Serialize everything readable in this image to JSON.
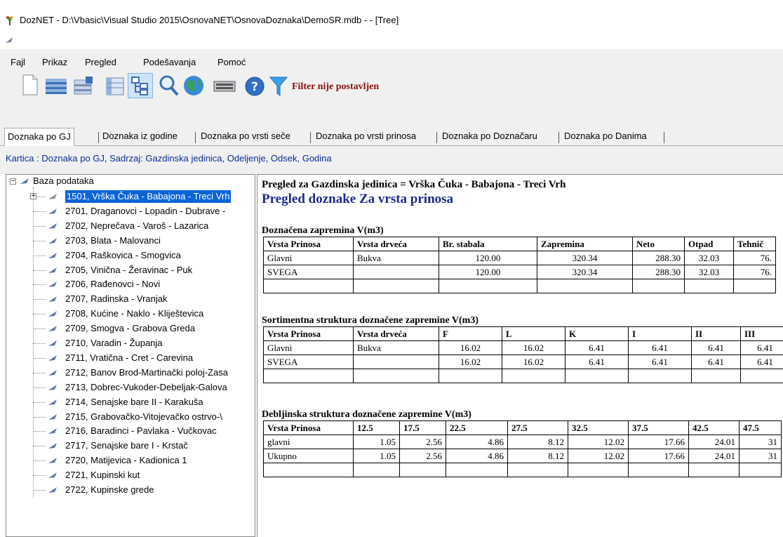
{
  "window": {
    "title": "DozNET - D:\\Vbasic\\Visual Studio 2015\\OsnovaNET\\OsnovaDoznaka\\DemoSR.mdb -  - [Tree]"
  },
  "menu": {
    "items": [
      "Fajl",
      "Prikaz",
      "Pregled",
      "Podešavanja",
      "Pomoć"
    ]
  },
  "toolbar": {
    "filter_text": "Filter nije postavljen"
  },
  "tabs": [
    "Doznaka po GJ",
    "Doznaka iz godine",
    "Doznaka po vrsti seče",
    "Doznaka po vrsti prinosa",
    "Doznaka po Doznačaru",
    "Doznaka po Danima"
  ],
  "kartica": "Kartica :  Doznaka po GJ, Sadrzaj: Gazdinska jedinica, Odeljenje, Odsek, Godina",
  "tree": {
    "root": "Baza podataka",
    "items": [
      "1501, Vrška Čuka - Babajona - Treci Vrh",
      "2701, Draganovci - Lopadin - Dubrave -",
      "2702, Neprečava - Varoš - Lazarica",
      "2703, Blata - Malovanci",
      "2704, Raškovica - Smogvica",
      "2705, Vinična - Žeravinac - Puk",
      "2706, Rađenovci - Novi",
      "2707, Radinska - Vranjak",
      "2708, Kućine - Naklo - Kliještevica",
      "2709, Smogva - Grabova Greda",
      "2710, Varadin - Županja",
      "2711, Vratična - Cret - Carevina",
      "2712, Banov Brod-Martinački poloj-Zasa",
      "2713, Dobrec-Vukoder-Debeljak-Galova",
      "2714, Senajske bare II - Karakuša",
      "2715, Grabovačko-Vitojevačko ostrvo-\\",
      "2716, Baradinci - Pavlaka - Vučkovac",
      "2717, Senajske bare I - Krstač",
      "2720, Matijevica - Kadionica 1",
      "2721, Kupinski kut",
      "2722, Kupinske grede"
    ]
  },
  "report": {
    "heading": "Pregled za Gazdinska jedinica = Vrška Čuka - Babajona - Treci Vrh",
    "title": "Pregled doznake Za vrsta prinosa",
    "section1": {
      "title": "Doznačena zapremina  V(m3)",
      "headers": [
        "Vrsta Prinosa",
        "Vrsta drveća",
        "Br. stabala",
        "Zapremina",
        "Neto",
        "Otpad",
        "Tehnič"
      ],
      "rows": [
        [
          "Glavni",
          "Bukva",
          "120.00",
          "320.34",
          "288.30",
          "32.03",
          "76."
        ],
        [
          "SVEGA",
          "",
          "120.00",
          "320.34",
          "288.30",
          "32.03",
          "76."
        ]
      ]
    },
    "section2": {
      "title": "Sortimentna struktura doznačene zapremine  V(m3)",
      "headers": [
        "Vrsta Prinosa",
        "Vrsta drveća",
        "F",
        "L",
        "K",
        "I",
        "II",
        "III"
      ],
      "rows": [
        [
          "Glavni",
          "Bukva",
          "16.02",
          "16.02",
          "6.41",
          "6.41",
          "6.41",
          "6.41"
        ],
        [
          "SVEGA",
          "",
          "16.02",
          "16.02",
          "6.41",
          "6.41",
          "6.41",
          "6.41"
        ]
      ]
    },
    "section3": {
      "title": "Debljinska struktura doznačene zapremine  V(m3)",
      "headers": [
        "Vrsta Prinosa",
        "12.5",
        "17.5",
        "22.5",
        "27.5",
        "32.5",
        "37.5",
        "42.5",
        "47.5"
      ],
      "rows": [
        [
          "glavni",
          "1.05",
          "2.56",
          "4.86",
          "8.12",
          "12.02",
          "17.66",
          "24.01",
          "31"
        ],
        [
          "Ukupno",
          "1.05",
          "2.56",
          "4.86",
          "8.12",
          "12.02",
          "17.66",
          "24.01",
          "31"
        ]
      ]
    }
  },
  "colors": {
    "accent": "#0a64d8",
    "title_blue": "#1c2a8c",
    "filter_red": "#8b1010",
    "kartica_blue": "#0a2e96"
  }
}
